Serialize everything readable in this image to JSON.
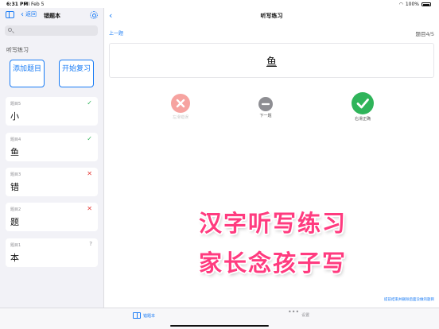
{
  "status_bar": {
    "time": "6:31 PM",
    "date": "Fri Feb 5",
    "battery": "100%"
  },
  "sidebar": {
    "back_label": "返回",
    "title": "错题本",
    "search_placeholder": "",
    "section_title": "听写练习",
    "add_button": "添加题目",
    "start_button": "开始复习",
    "items": [
      {
        "label": "题目5",
        "char": "小",
        "status": "✓"
      },
      {
        "label": "题目4",
        "char": "鱼",
        "status": "✓"
      },
      {
        "label": "题目3",
        "char": "错",
        "status": "✕"
      },
      {
        "label": "题目2",
        "char": "题",
        "status": "✕"
      },
      {
        "label": "题目1",
        "char": "本",
        "status": "?"
      }
    ]
  },
  "main": {
    "title": "听写练习",
    "prev_label": "上一题",
    "progress": "题目4/5",
    "word": "鱼",
    "actions": {
      "wrong_label": "左滑错误",
      "next_label": "下一题",
      "right_label": "右滑正确"
    },
    "promo_line1": "汉字听写练习",
    "promo_line2": "家长念孩子写",
    "footer_note": "提前结束并删除后面没做的题目"
  },
  "tabbar": {
    "tab1": "错题本",
    "tab2": "设置"
  },
  "colors": {
    "accent": "#1a7cf5",
    "success": "#2fb45a",
    "error": "#e53935",
    "promo": "#ff3b7f"
  }
}
